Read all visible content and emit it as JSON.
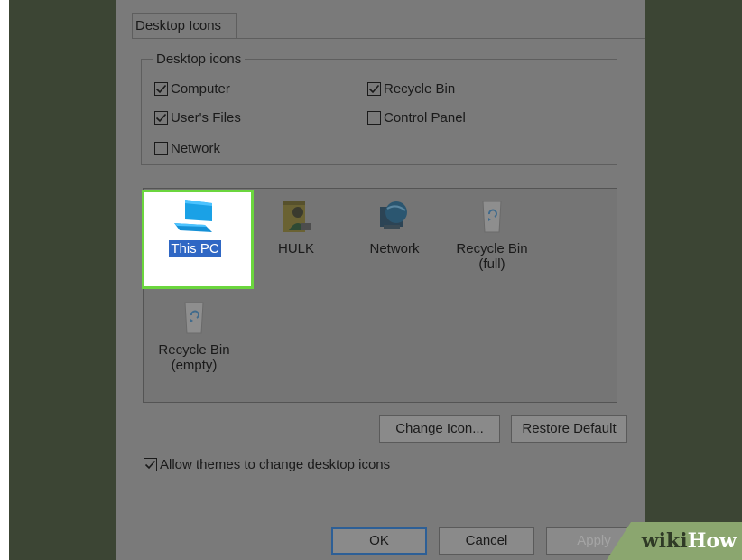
{
  "tab": {
    "label": "Desktop Icons"
  },
  "desktop_icons_group": {
    "legend": "Desktop icons",
    "checkboxes": [
      {
        "label": "Computer",
        "checked": true
      },
      {
        "label": "Recycle Bin",
        "checked": true
      },
      {
        "label": "User's Files",
        "checked": true
      },
      {
        "label": "Control Panel",
        "checked": false
      },
      {
        "label": "Network",
        "checked": false
      }
    ]
  },
  "icon_list": {
    "items": [
      {
        "label": "This PC",
        "icon": "monitor-icon",
        "selected": true
      },
      {
        "label": "HULK",
        "icon": "user-folder-icon",
        "selected": false
      },
      {
        "label": "Network",
        "icon": "network-globe-icon",
        "selected": false
      },
      {
        "label_line1": "Recycle Bin",
        "label_line2": "(full)",
        "icon": "recycle-bin-full-icon",
        "selected": false
      },
      {
        "label_line1": "Recycle Bin",
        "label_line2": "(empty)",
        "icon": "recycle-bin-empty-icon",
        "selected": false
      }
    ]
  },
  "buttons": {
    "change_icon": "Change Icon...",
    "restore_default": "Restore Default",
    "ok": "OK",
    "cancel": "Cancel",
    "apply": "Apply"
  },
  "allow_themes": {
    "label": "Allow themes to change desktop icons",
    "checked": true
  },
  "watermark": {
    "part1": "wiki",
    "part2": "How"
  },
  "colors": {
    "highlight_border": "#6bd63e",
    "selection": "#2f67c4",
    "dim_overlay": "#7a7a7a"
  }
}
